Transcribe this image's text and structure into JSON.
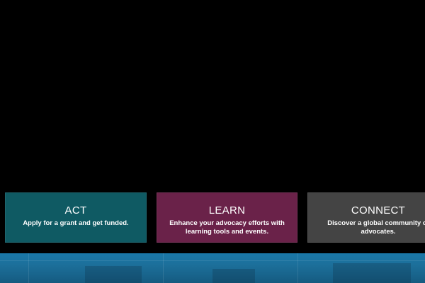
{
  "cards": [
    {
      "title": "ACT",
      "description": "Apply for a grant and get funded.",
      "color": "#0f5a63"
    },
    {
      "title": "LEARN",
      "description": "Enhance your advocacy efforts with learning tools and events.",
      "color": "#6a2249"
    },
    {
      "title": "CONNECT",
      "description": "Discover a global community of advocates.",
      "color": "#444444"
    }
  ],
  "theme": {
    "background": "#000000",
    "band_color": "#1a78a8"
  }
}
